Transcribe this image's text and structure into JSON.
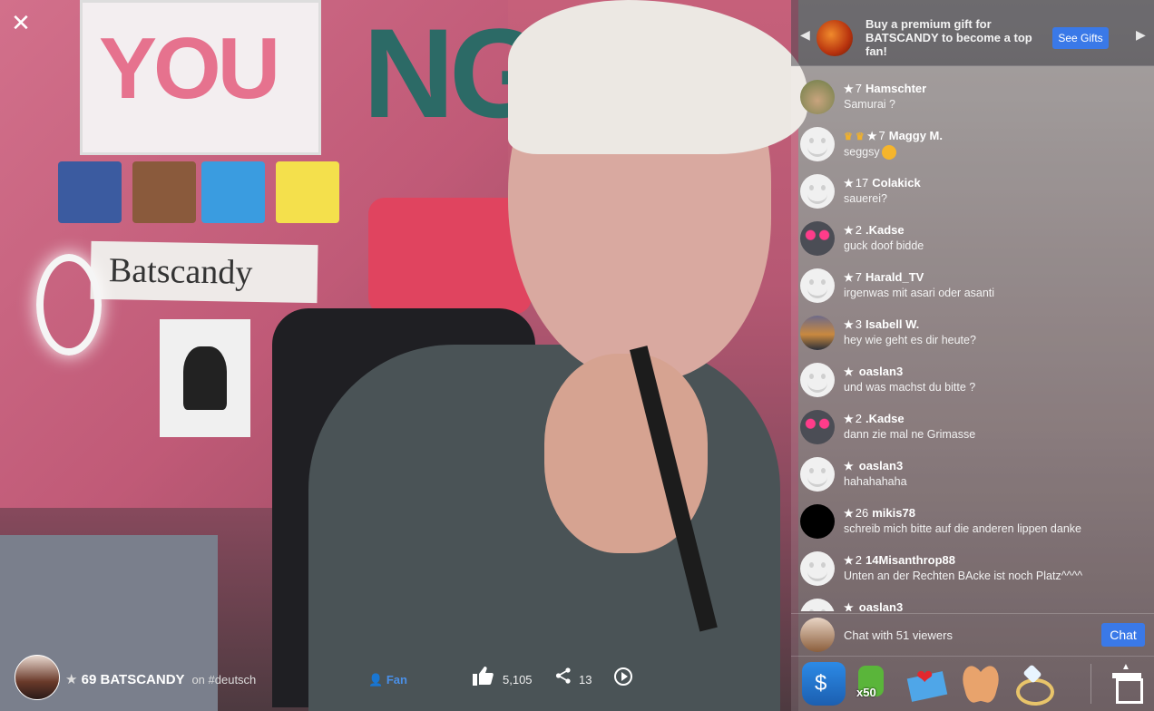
{
  "window": {
    "close_label": "✕"
  },
  "gift_banner": {
    "text": "Buy a premium gift for BATSCANDY to become a top fan!",
    "button": "See Gifts",
    "prev": "◀",
    "next": "▶"
  },
  "messages": [
    {
      "level": "7",
      "name": "Hamschter",
      "text": "Samurai ?",
      "avatar": "dog-avatar",
      "crowns": 0
    },
    {
      "level": "7",
      "name": "Maggy M.",
      "text": "seggsy",
      "avatar": "default-avatar",
      "crowns": 2,
      "emoji": "smiling-face-icon"
    },
    {
      "level": "17",
      "name": "Colakick",
      "text": "sauerei?",
      "avatar": "default-avatar",
      "crowns": 0
    },
    {
      "level": "2",
      "name": ".Kadse",
      "text": "guck doof bidde",
      "avatar": "cat-avatar",
      "crowns": 0
    },
    {
      "level": "7",
      "name": "Harald_TV",
      "text": "irgenwas mit asari oder asanti",
      "avatar": "default-avatar",
      "crowns": 0
    },
    {
      "level": "3",
      "name": "Isabell W.",
      "text": "hey wie geht es dir heute?",
      "avatar": "sunset-avatar",
      "crowns": 0
    },
    {
      "level": "",
      "name": "oaslan3",
      "text": "und was machst du bitte ?",
      "avatar": "default-avatar",
      "crowns": 0
    },
    {
      "level": "2",
      "name": ".Kadse",
      "text": "dann zie mal ne Grimasse",
      "avatar": "cat-avatar",
      "crowns": 0
    },
    {
      "level": "",
      "name": "oaslan3",
      "text": "hahahahaha",
      "avatar": "default-avatar",
      "crowns": 0
    },
    {
      "level": "26",
      "name": "mikis78",
      "text": "schreib mich bitte auf die anderen lippen danke",
      "avatar": "black-avatar",
      "crowns": 0
    },
    {
      "level": "2",
      "name": "14Misanthrop88",
      "text": "Unten an der Rechten BAcke ist noch Platz^^^^",
      "avatar": "default-avatar",
      "crowns": 0
    },
    {
      "level": "",
      "name": "oaslan3",
      "text": "",
      "avatar": "default-avatar",
      "crowns": 0
    }
  ],
  "chat_input": {
    "placeholder": "Chat with 51 viewers",
    "button": "Chat"
  },
  "gifts": {
    "jar_symbol": "$",
    "thumbs_label": "x50",
    "box_arrow": "▲"
  },
  "host": {
    "star": "★",
    "level": "69",
    "name": "BATSCANDY",
    "on_text": "on #deutsch"
  },
  "actions": {
    "fan_label": "Fan",
    "like_count": "5,105",
    "share_count": "13"
  },
  "colors": {
    "accent": "#3a79e8",
    "crown": "#f0b12c"
  }
}
